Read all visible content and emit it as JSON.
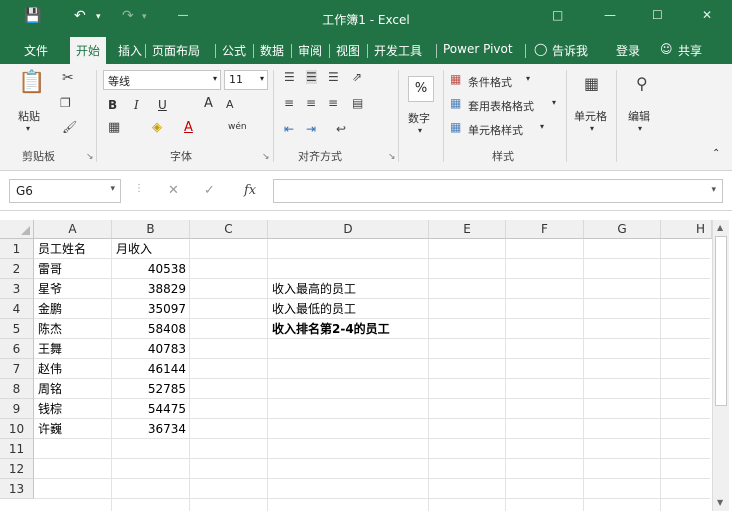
{
  "window": {
    "title": "工作簿1 - Excel",
    "save_icon": "save-icon",
    "undo_icon": "undo-icon",
    "redo_icon": "redo-icon",
    "customize_icon": "customize-qat-icon"
  },
  "tabs": [
    {
      "label": "文件"
    },
    {
      "label": "开始"
    },
    {
      "label": "插入"
    },
    {
      "label": "页面布局"
    },
    {
      "label": "公式"
    },
    {
      "label": "数据"
    },
    {
      "label": "审阅"
    },
    {
      "label": "视图"
    },
    {
      "label": "开发工具"
    },
    {
      "label": "Power Pivot"
    },
    {
      "label": "告诉我"
    },
    {
      "label": "登录"
    },
    {
      "label": "共享"
    }
  ],
  "ribbon": {
    "clipboard": {
      "paste": "粘贴",
      "group": "剪贴板"
    },
    "font": {
      "name": "等线",
      "size": "11",
      "bold": "B",
      "italic": "I",
      "underline": "U",
      "grow": "A",
      "shrink": "A",
      "phonetic": "wén",
      "group": "字体"
    },
    "alignment": {
      "group": "对齐方式"
    },
    "number": {
      "label": "数字",
      "percent": "%"
    },
    "styles": {
      "conditional": "条件格式",
      "table": "套用表格格式",
      "cell": "单元格样式",
      "group": "样式"
    },
    "cells": {
      "label": "单元格"
    },
    "editing": {
      "label": "编辑"
    }
  },
  "formula_bar": {
    "name_box": "G6",
    "fx": "fx",
    "value": ""
  },
  "columns": [
    "A",
    "B",
    "C",
    "D",
    "E",
    "F",
    "G",
    "H"
  ],
  "rows": [
    "1",
    "2",
    "3",
    "4",
    "5",
    "6",
    "7",
    "8",
    "9",
    "10",
    "11",
    "12",
    "13"
  ],
  "cells": {
    "A1": "员工姓名",
    "B1": "月收入",
    "A2": "雷哥",
    "B2": "40538",
    "A3": "星爷",
    "B3": "38829",
    "A4": "金鹏",
    "B4": "35097",
    "A5": "陈杰",
    "B5": "58408",
    "A6": "王舞",
    "B6": "40783",
    "A7": "赵伟",
    "B7": "46144",
    "A8": "周铭",
    "B8": "52785",
    "A9": "钱棕",
    "B9": "54475",
    "A10": "许巍",
    "B10": "36734",
    "D3": "收入最高的员工",
    "D4": "收入最低的员工",
    "D5": "收入排名第2-4的员工"
  },
  "colors": {
    "accent": "#217346"
  }
}
